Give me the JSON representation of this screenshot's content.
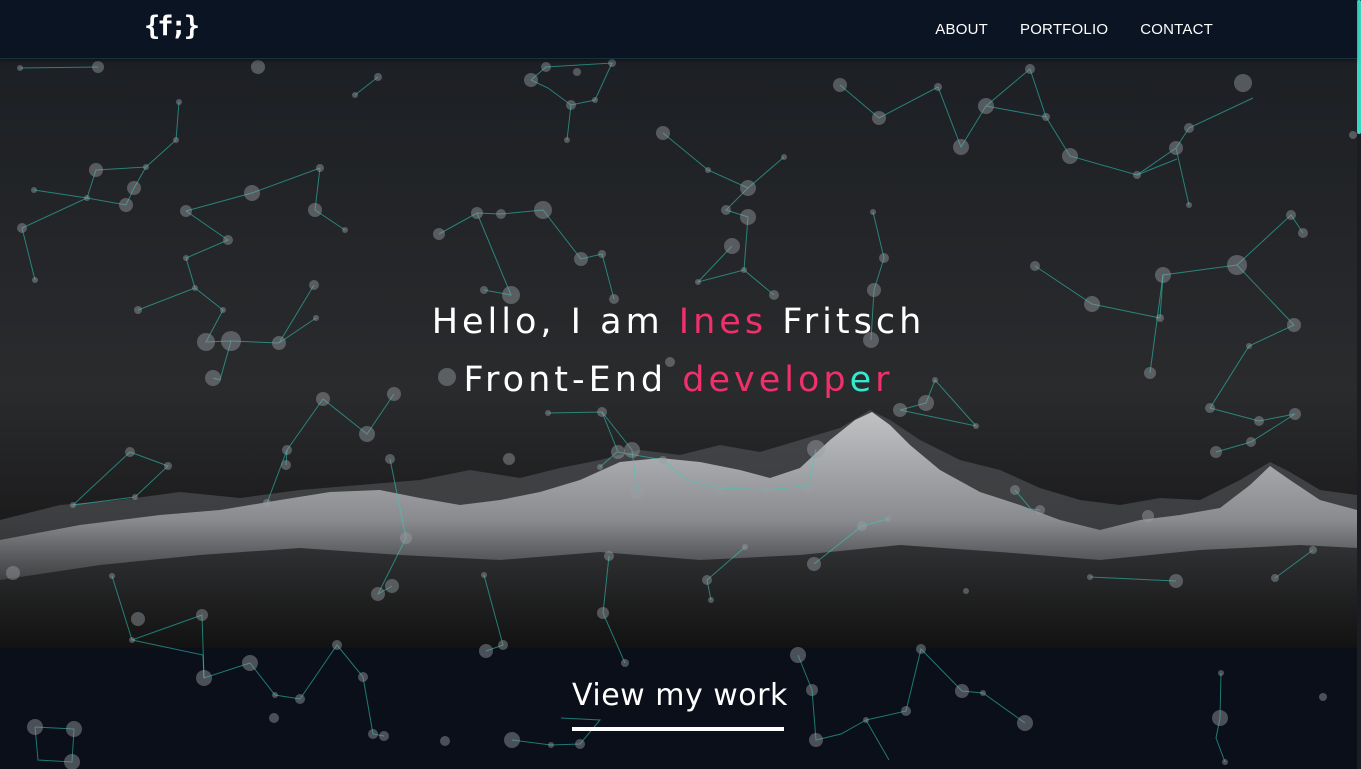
{
  "navbar": {
    "logo": "{f;}",
    "links": [
      "ABOUT",
      "PORTFOLIO",
      "CONTACT"
    ]
  },
  "hero": {
    "line1_prefix": "Hello, I am ",
    "line1_name": "Ines",
    "line1_surname": " Fritsch",
    "line2_prefix": "Front-End ",
    "line2_word_start": "develop",
    "line2_word_cursor": "e",
    "line2_word_end": "r"
  },
  "cta": {
    "label": "View my work"
  },
  "colors": {
    "accent_pink": "#f0306b",
    "accent_teal": "#36e8cf",
    "navbar_bg": "#0a1423"
  }
}
